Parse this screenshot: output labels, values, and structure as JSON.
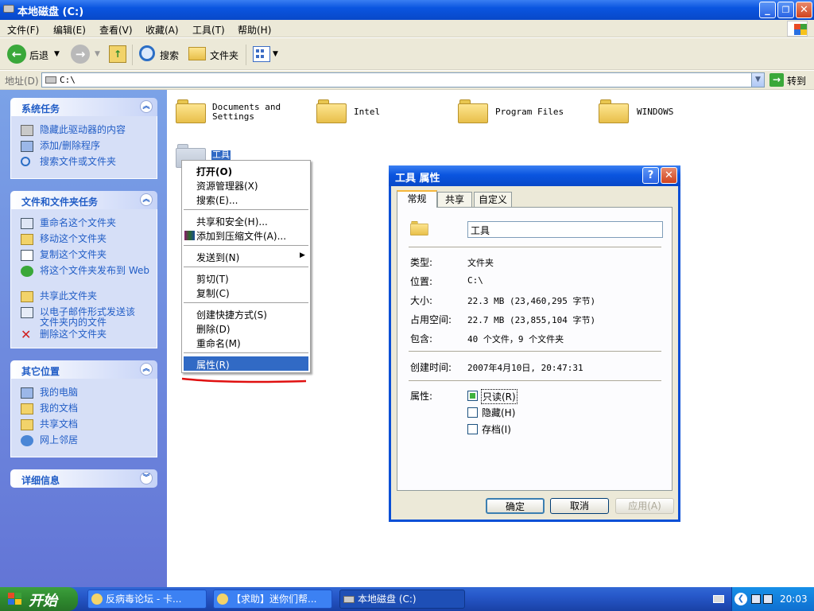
{
  "window": {
    "title": "本地磁盘 (C:)"
  },
  "menu": [
    "文件(F)",
    "编辑(E)",
    "查看(V)",
    "收藏(A)",
    "工具(T)",
    "帮助(H)"
  ],
  "toolbar": {
    "back": "后退",
    "search": "搜索",
    "folders": "文件夹"
  },
  "address": {
    "label": "地址(D)",
    "value": "C:\\",
    "go": "转到"
  },
  "sidebar": {
    "system_tasks": {
      "title": "系统任务",
      "items": [
        "隐藏此驱动器的内容",
        "添加/删除程序",
        "搜索文件或文件夹"
      ]
    },
    "file_tasks": {
      "title": "文件和文件夹任务",
      "items": [
        "重命名这个文件夹",
        "移动这个文件夹",
        "复制这个文件夹",
        "将这个文件夹发布到 Web",
        "共享此文件夹",
        "以电子邮件形式发送该文件夹内的文件",
        "删除这个文件夹"
      ]
    },
    "other_places": {
      "title": "其它位置",
      "items": [
        "我的电脑",
        "我的文档",
        "共享文档",
        "网上邻居"
      ]
    },
    "details": {
      "title": "详细信息"
    }
  },
  "folders": [
    "Documents and Settings",
    "Intel",
    "Program Files",
    "WINDOWS",
    "工具"
  ],
  "context_menu": {
    "items": [
      "打开(O)",
      "资源管理器(X)",
      "搜索(E)...",
      "共享和安全(H)...",
      "添加到压缩文件(A)...",
      "发送到(N)",
      "剪切(T)",
      "复制(C)",
      "创建快捷方式(S)",
      "删除(D)",
      "重命名(M)",
      "属性(R)"
    ]
  },
  "dialog": {
    "title": "工具 属性",
    "tabs": [
      "常规",
      "共享",
      "自定义"
    ],
    "name": "工具",
    "fields": {
      "type_label": "类型:",
      "type": "文件夹",
      "location_label": "位置:",
      "location": "C:\\",
      "size_label": "大小:",
      "size": "22.3 MB (23,460,295 字节)",
      "disk_size_label": "占用空间:",
      "disk_size": "22.7 MB (23,855,104 字节)",
      "contains_label": "包含:",
      "contains": "40 个文件，9 个文件夹",
      "created_label": "创建时间:",
      "created": "2007年4月10日, 20:47:31",
      "attributes_label": "属性:"
    },
    "attributes": [
      "只读(R)",
      "隐藏(H)",
      "存档(I)"
    ],
    "buttons": {
      "ok": "确定",
      "cancel": "取消",
      "apply": "应用(A)"
    }
  },
  "taskbar": {
    "start": "开始",
    "items": [
      "反病毒论坛 - 卡...",
      "【求助】迷你们帮...",
      "本地磁盘 (C:)"
    ],
    "clock": "20:03"
  }
}
